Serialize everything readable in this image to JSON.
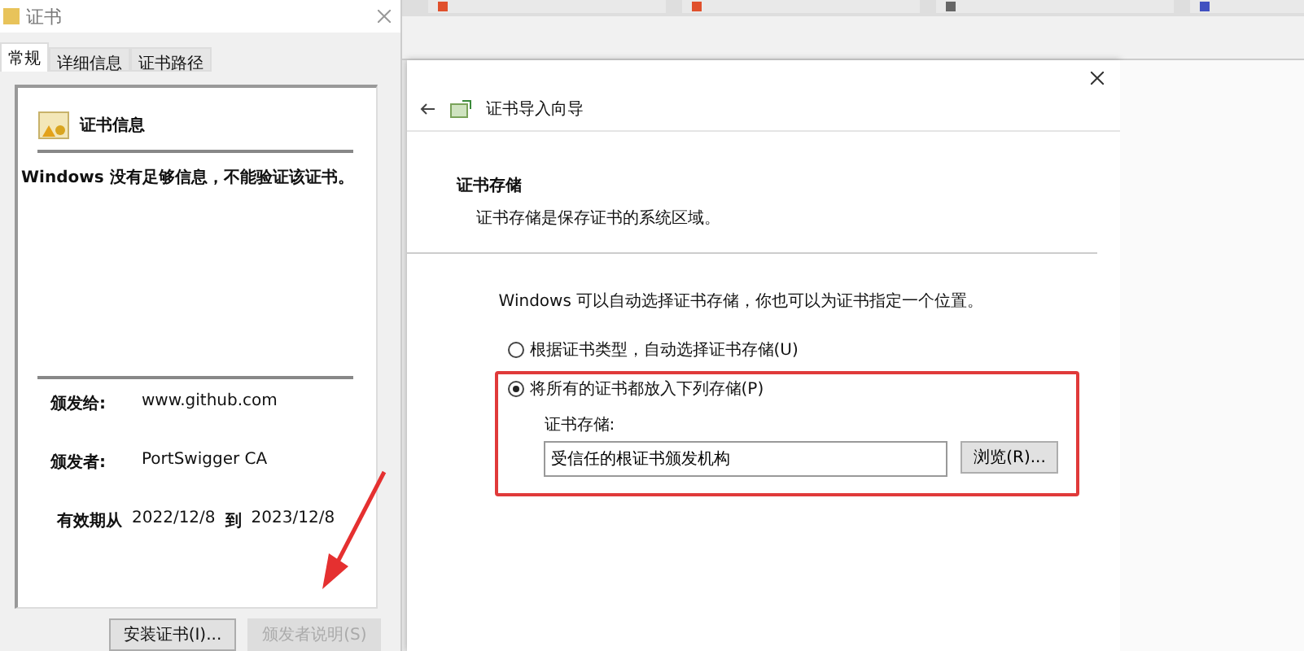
{
  "cert_dialog": {
    "title": "证书",
    "tabs": [
      {
        "label": "常规",
        "selected": true
      },
      {
        "label": "详细信息",
        "selected": false
      },
      {
        "label": "证书路径",
        "selected": false
      }
    ],
    "info_heading": "证书信息",
    "warning": "Windows 没有足够信息，不能验证该证书。",
    "fields": [
      {
        "label": "颁发给:",
        "value": "www.github.com"
      },
      {
        "label": "颁发者:",
        "value": "PortSwigger CA"
      }
    ],
    "validity": {
      "label": "有效期从",
      "from": "2022/12/8",
      "to_word": "到",
      "to": "2023/12/8"
    },
    "buttons": [
      {
        "label": "安装证书(I)...",
        "disabled": false
      },
      {
        "label": "颁发者说明(S)",
        "disabled": true
      }
    ]
  },
  "wizard": {
    "title": "证书导入向导",
    "section_title": "证书存储",
    "section_desc": "证书存储是保存证书的系统区域。",
    "intro": "Windows 可以自动选择证书存储，你也可以为证书指定一个位置。",
    "options": [
      {
        "label": "根据证书类型，自动选择证书存储(U)",
        "selected": false
      },
      {
        "label": "将所有的证书都放入下列存储(P)",
        "selected": true,
        "highlighted": true
      }
    ],
    "store_label": "证书存储:",
    "store_value": "受信任的根证书颁发机构",
    "browse_button": "浏览(R)..."
  }
}
